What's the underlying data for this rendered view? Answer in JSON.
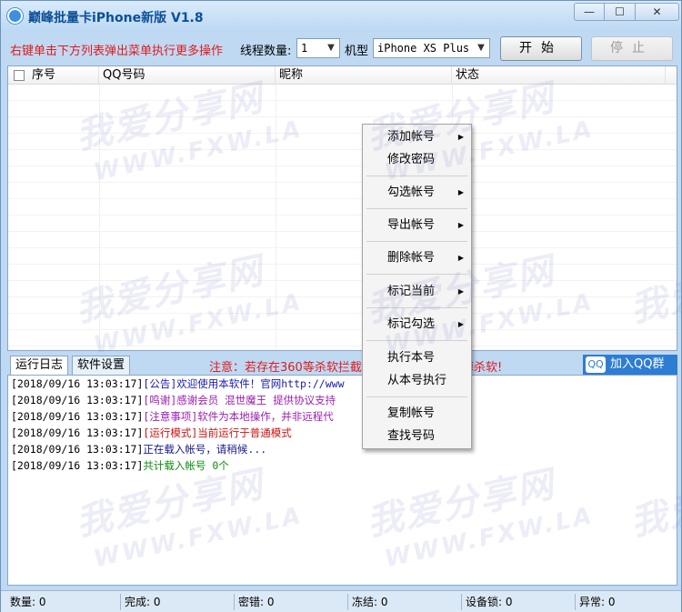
{
  "window": {
    "title": "巅峰批量卡iPhone新版 V1.8",
    "controls": {
      "minimize": "—",
      "maximize": "☐",
      "close": "✕"
    }
  },
  "toolbar": {
    "hint": "右键单击下方列表弹出菜单执行更多操作",
    "threads_label": "线程数量:",
    "threads_value": "1",
    "model_label": "机型",
    "model_value": "iPhone XS Plus",
    "start_label": "开始",
    "stop_label": "停止"
  },
  "table": {
    "columns": [
      "序号",
      "QQ号码",
      "昵称",
      "状态"
    ],
    "rows": []
  },
  "context_menu": {
    "items": [
      {
        "label": "添加帐号",
        "submenu": true
      },
      {
        "label": "修改密码",
        "submenu": false
      },
      {
        "label": "勾选帐号",
        "submenu": true
      },
      {
        "label": "导出帐号",
        "submenu": true
      },
      {
        "label": "删除帐号",
        "submenu": true
      },
      {
        "label": "标记当前",
        "submenu": true
      },
      {
        "label": "标记勾选",
        "submenu": true
      },
      {
        "label": "执行本号",
        "submenu": false
      },
      {
        "label": "从本号执行",
        "submenu": false
      },
      {
        "label": "复制帐号",
        "submenu": false
      },
      {
        "label": "查找号码",
        "submenu": false
      }
    ]
  },
  "tabs": [
    {
      "label": "运行日志",
      "active": true
    },
    {
      "label": "软件设置",
      "active": false
    }
  ],
  "notice": {
    "text": "注意：若存在360等杀软拦截",
    "tail": "掉杀软!"
  },
  "join_qq": {
    "label": "加入QQ群",
    "icon_text": "QQ"
  },
  "log": [
    {
      "time": "[2018/09/16 13:03:17]",
      "text": "[公告]欢迎使用本软件！官网http://www",
      "color": "c-blue"
    },
    {
      "time": "[2018/09/16 13:03:17]",
      "text": "[鸣谢]感谢会员 混世魔王 提供协议支持",
      "color": "c-purple"
    },
    {
      "time": "[2018/09/16 13:03:17]",
      "text": "[注意事项]软件为本地操作，并非远程代",
      "color": "c-purple"
    },
    {
      "time": "[2018/09/16 13:03:17]",
      "text": "[运行模式]当前运行于普通模式",
      "color": "c-red"
    },
    {
      "time": "[2018/09/16 13:03:17]",
      "text": "正在载入帐号，请稍候...",
      "color": "c-navy"
    },
    {
      "time": "[2018/09/16 13:03:17]",
      "text": "共计载入帐号 0个",
      "color": "c-green"
    }
  ],
  "status": {
    "count": "数量: 0",
    "done": "完成: 0",
    "pwd_error": "密错: 0",
    "frozen": "冻结: 0",
    "device_lock": "设备锁: 0",
    "abnormal": "异常: 0"
  },
  "watermark": {
    "cn": "我爱分享网",
    "en": "WWW.FXW.LA"
  },
  "colors": {
    "accent": "#2d7dd2",
    "alert": "#e01b1b",
    "title": "#0d4f98"
  }
}
